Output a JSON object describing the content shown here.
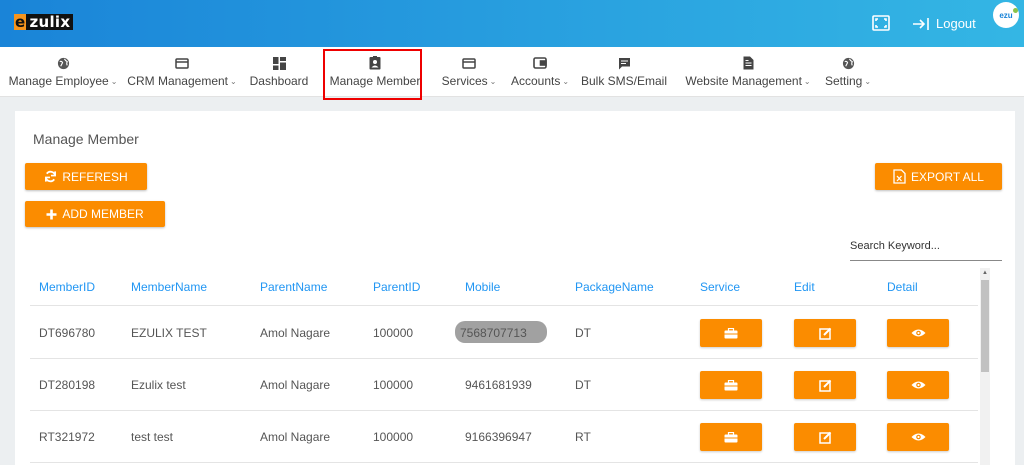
{
  "app": {
    "logo_first": "e",
    "logo_rest": "zulix",
    "avatar_text": "ezu"
  },
  "topbar": {
    "logout_label": "Logout",
    "fullscreen_icon": "fullscreen-icon"
  },
  "nav": {
    "items": [
      {
        "label": "Manage Employee",
        "icon": "globe-icon",
        "dropdown": true
      },
      {
        "label": "CRM Management",
        "icon": "card-icon",
        "dropdown": true
      },
      {
        "label": "Dashboard",
        "icon": "dashboard-icon",
        "dropdown": false
      },
      {
        "label": "Manage Member",
        "icon": "member-badge-icon",
        "dropdown": false
      },
      {
        "label": "Services",
        "icon": "card-icon",
        "dropdown": true
      },
      {
        "label": "Accounts",
        "icon": "wallet-icon",
        "dropdown": true
      },
      {
        "label": "Bulk SMS/Email",
        "icon": "message-icon",
        "dropdown": false
      },
      {
        "label": "Website Management",
        "icon": "document-icon",
        "dropdown": true
      },
      {
        "label": "Setting",
        "icon": "globe-icon",
        "dropdown": true
      }
    ],
    "active": "Manage Member"
  },
  "page": {
    "title": "Manage Member",
    "refresh_label": "REFERESH",
    "add_label": "ADD MEMBER",
    "export_label": "EXPORT ALL",
    "search_placeholder": "Search Keyword..."
  },
  "table": {
    "columns": [
      "MemberID",
      "MemberName",
      "ParentName",
      "ParentID",
      "Mobile",
      "PackageName",
      "Service",
      "Edit",
      "Detail"
    ],
    "rows": [
      {
        "member_id": "DT696780",
        "member_name": "EZULIX TEST",
        "parent_name": "Amol Nagare",
        "parent_id": "100000",
        "mobile": "7568707713",
        "package": "DT",
        "mobile_redacted": true
      },
      {
        "member_id": "DT280198",
        "member_name": "Ezulix test",
        "parent_name": "Amol Nagare",
        "parent_id": "100000",
        "mobile": "9461681939",
        "package": "DT",
        "mobile_redacted": false
      },
      {
        "member_id": "RT321972",
        "member_name": "test test",
        "parent_name": "Amol Nagare",
        "parent_id": "100000",
        "mobile": "9166396947",
        "package": "RT",
        "mobile_redacted": false
      }
    ]
  },
  "colors": {
    "accent": "#fb8c00",
    "header": "#2196f3",
    "topbar_start": "#1a84d8",
    "topbar_end": "#34b6e4",
    "highlight": "#ee0000"
  }
}
